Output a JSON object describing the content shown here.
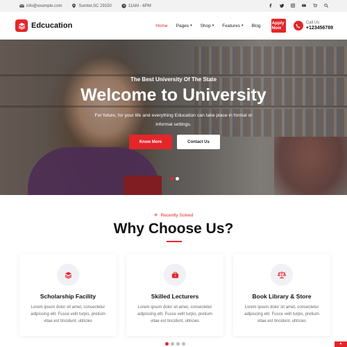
{
  "topbar": {
    "email": "info@example.com",
    "location": "Sumter,SC 29150",
    "hours": "11AM - 6PM",
    "socials": [
      "facebook-icon",
      "twitter-icon",
      "instagram-icon",
      "youtube-icon",
      "cart-icon",
      "search-icon"
    ]
  },
  "header": {
    "logo": "Edcucation",
    "nav": [
      {
        "label": "Home",
        "active": true,
        "dropdown": false
      },
      {
        "label": "Pages",
        "active": false,
        "dropdown": true
      },
      {
        "label": "Shop",
        "active": false,
        "dropdown": true
      },
      {
        "label": "Features",
        "active": false,
        "dropdown": true
      },
      {
        "label": "Blog",
        "active": false,
        "dropdown": false
      }
    ],
    "apply_label": "Apply Now",
    "call_label": "Call Us",
    "call_number": "+123456789"
  },
  "hero": {
    "subtitle": "The Best University Of The State",
    "title": "Welcome to University",
    "description": "For future, for your life and everything Education can take place in formal or informal settings.",
    "know_more": "Know More",
    "contact_us": "Contact Us",
    "slides": 2,
    "active_slide": 0
  },
  "why": {
    "tag": "Recently Solved",
    "title": "Why Choose Us?",
    "cards": [
      {
        "icon": "layers-icon",
        "title": "Scholarship Facility",
        "desc": "Lorem ipsum dolor sit amet, consectetur adipiscing elit. Fusce velit turpis, pretium vitae est tincidunt, ultricies"
      },
      {
        "icon": "briefcase-icon",
        "title": "Skilled Lecturers",
        "desc": "Lorem ipsum dolor sit amet, consectetur adipiscing elit. Fusce velit turpis, pretium vitae est tincidunt, ultricies"
      },
      {
        "icon": "scale-icon",
        "title": "Book Library & Store",
        "desc": "Lorem ipsum dolor sit amet, consectetur adipiscing elit. Fusce velit turpis, pretium vitae est tincidunt, ultricies"
      }
    ],
    "pages": 4,
    "active_page": 0
  },
  "colors": {
    "accent": "#e4262a",
    "text": "#111111"
  }
}
